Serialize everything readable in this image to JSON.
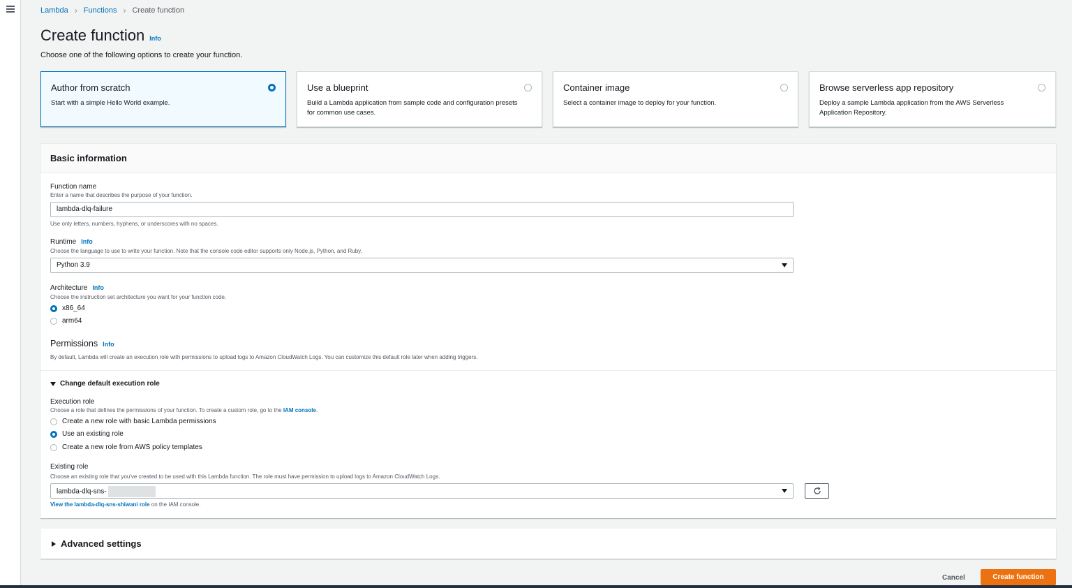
{
  "breadcrumb": {
    "lambda": "Lambda",
    "functions": "Functions",
    "current": "Create function"
  },
  "page": {
    "title": "Create function",
    "info": "Info",
    "subtitle": "Choose one of the following options to create your function."
  },
  "options": [
    {
      "title": "Author from scratch",
      "desc": "Start with a simple Hello World example.",
      "selected": true
    },
    {
      "title": "Use a blueprint",
      "desc": "Build a Lambda application from sample code and configuration presets for common use cases.",
      "selected": false
    },
    {
      "title": "Container image",
      "desc": "Select a container image to deploy for your function.",
      "selected": false
    },
    {
      "title": "Browse serverless app repository",
      "desc": "Deploy a sample Lambda application from the AWS Serverless Application Repository.",
      "selected": false
    }
  ],
  "basic": {
    "header": "Basic information",
    "function_name": {
      "label": "Function name",
      "desc": "Enter a name that describes the purpose of your function.",
      "value": "lambda-dlq-failure",
      "constraint": "Use only letters, numbers, hyphens, or underscores with no spaces."
    },
    "runtime": {
      "label": "Runtime",
      "info": "Info",
      "desc": "Choose the language to use to write your function. Note that the console code editor supports only Node.js, Python, and Ruby.",
      "value": "Python 3.9"
    },
    "architecture": {
      "label": "Architecture",
      "info": "Info",
      "desc": "Choose the instruction set architecture you want for your function code.",
      "options": [
        "x86_64",
        "arm64"
      ],
      "selected": "x86_64"
    },
    "permissions": {
      "title": "Permissions",
      "info": "Info",
      "desc": "By default, Lambda will create an execution role with permissions to upload logs to Amazon CloudWatch Logs. You can customize this default role later when adding triggers."
    },
    "change_role": "Change default execution role",
    "execution_role": {
      "label": "Execution role",
      "desc_prefix": "Choose a role that defines the permissions of your function. To create a custom role, go to the ",
      "desc_link": "IAM console",
      "desc_suffix": ".",
      "options": [
        "Create a new role with basic Lambda permissions",
        "Use an existing role",
        "Create a new role from AWS policy templates"
      ],
      "selected": "Use an existing role"
    },
    "existing_role": {
      "label": "Existing role",
      "desc": "Choose an existing role that you've created to be used with this Lambda function. The role must have permission to upload logs to Amazon CloudWatch Logs.",
      "value": "lambda-dlq-sns-",
      "view_link": "View the lambda-dlq-sns-shiwani role",
      "view_suffix": " on the IAM console."
    }
  },
  "advanced": {
    "label": "Advanced settings"
  },
  "footer": {
    "cancel": "Cancel",
    "create": "Create function"
  },
  "colors": {
    "accent": "#0073bb",
    "primary_button": "#ec7211",
    "background": "#f2f3f3"
  }
}
